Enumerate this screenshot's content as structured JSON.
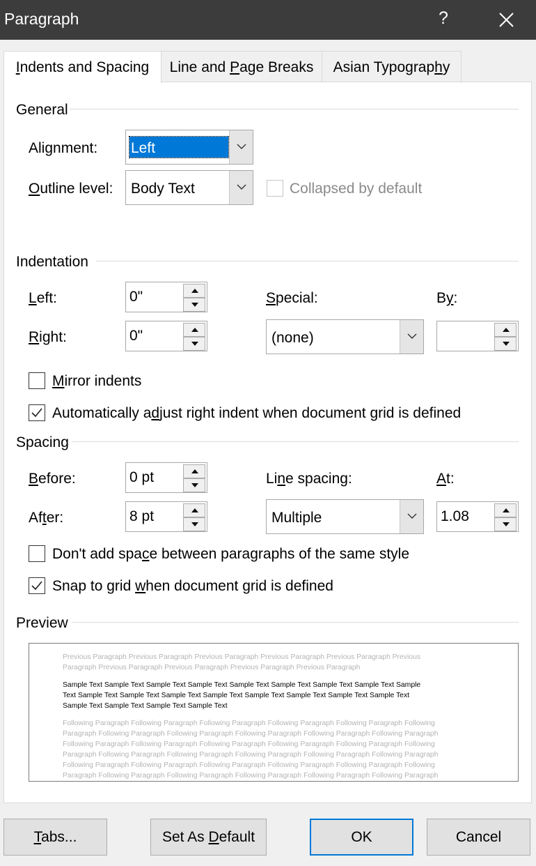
{
  "window": {
    "title": "Paragraph",
    "help_glyph": "?"
  },
  "tabs": [
    {
      "label_pre": "",
      "label_key": "I",
      "label_post": "ndents and Spacing",
      "active": true
    },
    {
      "label_pre": "Line and ",
      "label_key": "P",
      "label_post": "age Breaks",
      "active": false
    },
    {
      "label_pre": "Asian Typograp",
      "label_key": "h",
      "label_post": "y",
      "active": false
    }
  ],
  "general": {
    "title": "General",
    "alignment": {
      "label_pre": "Ali",
      "label_key": "g",
      "label_post": "nment:",
      "value": "Left"
    },
    "outline": {
      "label_pre": "",
      "label_key": "O",
      "label_post": "utline level:",
      "value": "Body Text"
    },
    "collapsed": {
      "label": "Collapsed by default",
      "checked": false,
      "enabled": false
    }
  },
  "indentation": {
    "title": "Indentation",
    "left": {
      "label_pre": "",
      "label_key": "L",
      "label_post": "eft:",
      "value": "0\""
    },
    "right": {
      "label_pre": "",
      "label_key": "R",
      "label_post": "ight:",
      "value": "0\""
    },
    "special": {
      "label_pre": "",
      "label_key": "S",
      "label_post": "pecial:",
      "value": "(none)"
    },
    "by": {
      "label_pre": "B",
      "label_key": "y",
      "label_post": ":",
      "value": ""
    },
    "mirror": {
      "label_pre": "",
      "label_key": "M",
      "label_post": "irror indents",
      "checked": false
    },
    "auto_adjust": {
      "label_pre": "Automatically a",
      "label_key": "d",
      "label_post": "just right indent when document grid is defined",
      "checked": true
    }
  },
  "spacing": {
    "title": "Spacing",
    "before": {
      "label_pre": "",
      "label_key": "B",
      "label_post": "efore:",
      "value": "0 pt"
    },
    "after": {
      "label_pre": "Af",
      "label_key": "t",
      "label_post": "er:",
      "value": "8 pt"
    },
    "line_spacing": {
      "label_pre": "Li",
      "label_key": "n",
      "label_post": "e spacing:",
      "value": "Multiple"
    },
    "at": {
      "label_pre": "",
      "label_key": "A",
      "label_post": "t:",
      "value": "1.08"
    },
    "dont_add": {
      "label_pre": "Don't add spa",
      "label_key": "c",
      "label_post": "e between paragraphs of the same style",
      "checked": false
    },
    "snap": {
      "label_pre": "Snap to grid ",
      "label_key": "w",
      "label_post": "hen document grid is defined",
      "checked": true
    }
  },
  "preview": {
    "title": "Preview",
    "previous": [
      "Previous Paragraph Previous Paragraph Previous Paragraph Previous Paragraph Previous Paragraph Previous",
      "Paragraph Previous Paragraph Previous Paragraph Previous Paragraph Previous Paragraph"
    ],
    "sample": [
      "Sample Text Sample Text Sample Text Sample Text Sample Text Sample Text Sample Text Sample Text Sample",
      "Text Sample Text Sample Text Sample Text Sample Text Sample Text Sample Text Sample Text Sample Text",
      "Sample Text Sample Text Sample Text Sample Text"
    ],
    "following": [
      "Following Paragraph Following Paragraph Following Paragraph Following Paragraph Following Paragraph Following",
      "Paragraph Following Paragraph Following Paragraph Following Paragraph Following Paragraph Following Paragraph",
      "Following Paragraph Following Paragraph Following Paragraph Following Paragraph Following Paragraph Following",
      "Paragraph Following Paragraph Following Paragraph Following Paragraph Following Paragraph Following Paragraph",
      "Following Paragraph Following Paragraph Following Paragraph Following Paragraph Following Paragraph Following",
      "Paragraph Following Paragraph Following Paragraph Following Paragraph Following Paragraph Following Paragraph"
    ]
  },
  "buttons": {
    "tabs": {
      "label_pre": "",
      "label_key": "T",
      "label_post": "abs..."
    },
    "set_default": {
      "label_pre": "Set As ",
      "label_key": "D",
      "label_post": "efault"
    },
    "ok": "OK",
    "cancel": "Cancel"
  },
  "colors": {
    "titlebar": "#3c3c3c",
    "selection": "#0078d7",
    "default_button_border": "#0078d7"
  }
}
